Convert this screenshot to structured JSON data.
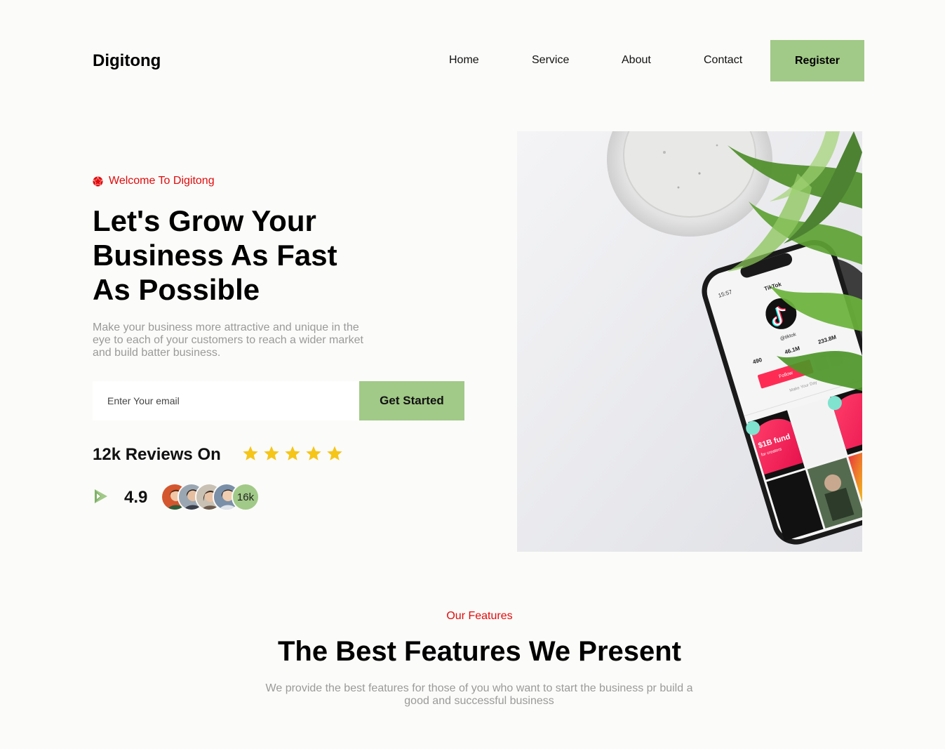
{
  "header": {
    "logo": "Digitong",
    "nav": [
      "Home",
      "Service",
      "About",
      "Contact"
    ],
    "register_label": "Register"
  },
  "hero": {
    "eyebrow": "Welcome To Digitong",
    "title_lines": [
      "Let's Grow Your",
      "Business As Fast",
      "As Possible"
    ],
    "description": "Make your business more attractive and unique in the eye to each of your customers to reach a wider market and build batter business.",
    "email_placeholder": "Enter Your email",
    "cta_label": "Get Started",
    "reviews_label": "12k Reviews On",
    "star_rating": 5,
    "rating": "4.9",
    "avatar_count": "16k"
  },
  "phone_screen": {
    "time": "15:57",
    "app_title": "TikTok",
    "username": "@tiktok",
    "stats": [
      "490",
      "46.1M",
      "233.8M"
    ],
    "follow_label": "Follow",
    "bio": "Make Your Day",
    "video_caption": "$1B fund",
    "video_sub": "for creators"
  },
  "features": {
    "eyebrow": "Our Features",
    "title": "The Best Features We Present",
    "description": "We provide the best features for those of you who want to start the business pr build a good and successful business"
  },
  "colors": {
    "accent_green": "#a1c987",
    "accent_red": "#e10b0b",
    "star_yellow": "#f5c518",
    "background": "#fbfbf9"
  }
}
